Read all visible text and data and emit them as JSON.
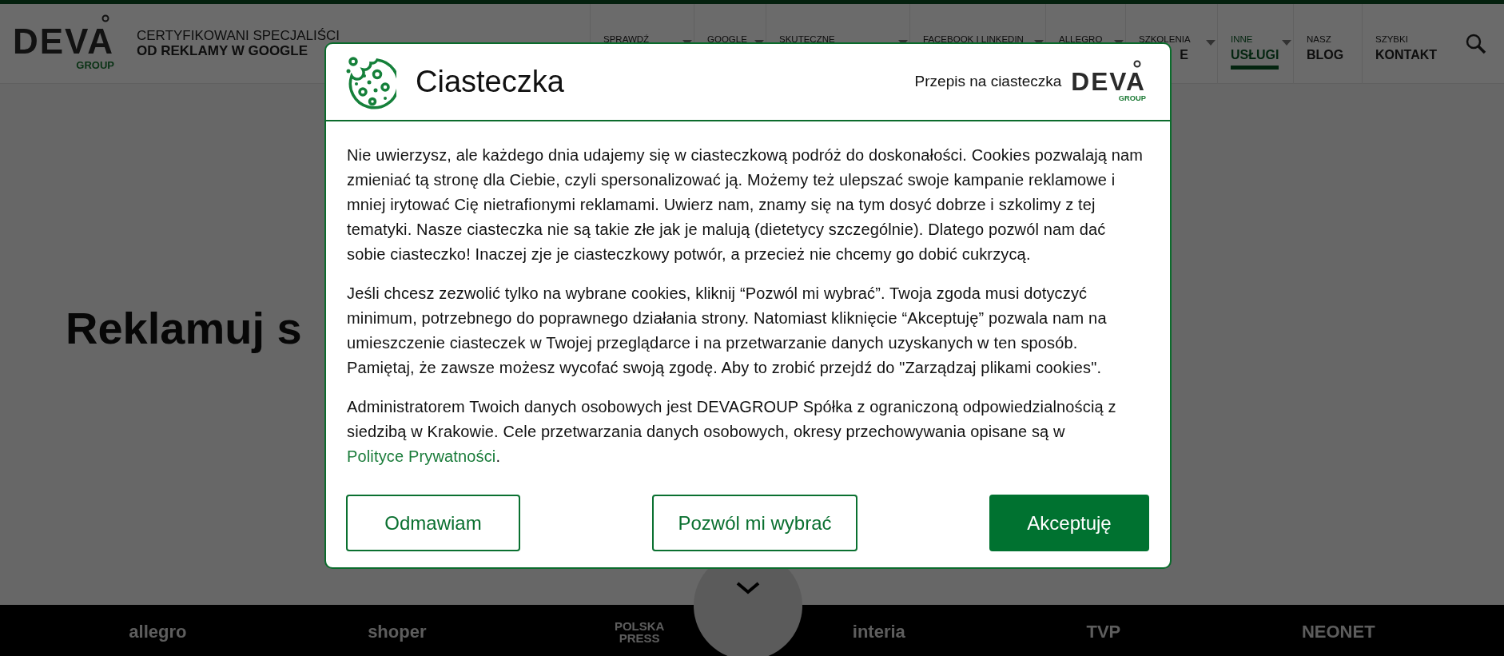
{
  "header": {
    "logo": {
      "word": "DEVA",
      "sub": "GROUP"
    },
    "tagline": {
      "top": "CERTYFIKOWANI SPECJALIŚCI",
      "bottom": "OD REKLAMY W GOOGLE"
    },
    "nav": [
      {
        "top": "SPRAWDŹ",
        "dropdown": true,
        "selected": false
      },
      {
        "top": "GOOGLE",
        "dropdown": true,
        "selected": false
      },
      {
        "top": "SKUTECZNE",
        "dropdown": true,
        "selected": false
      },
      {
        "top": "FACEBOOK I LINKEDIN",
        "dropdown": true,
        "selected": false
      },
      {
        "top": "ALLEGRO",
        "dropdown": true,
        "selected": false
      },
      {
        "top": "SZKOLENIA",
        "bottom": "E",
        "dropdown": true,
        "selected": false
      },
      {
        "top": "INNE",
        "bottom": "USŁUGI",
        "dropdown": true,
        "selected": true
      },
      {
        "top": "NASZ",
        "bottom": "BLOG",
        "dropdown": false,
        "selected": false
      },
      {
        "top": "SZYBKI",
        "bottom": "KONTAKT",
        "dropdown": false,
        "selected": false
      }
    ]
  },
  "hero": {
    "heading": "Reklamuj s"
  },
  "partners": [
    "allegro",
    "shoper",
    "POLSKA PRESS",
    "interia",
    "TVP",
    "NEONET"
  ],
  "cookie_dialog": {
    "title": "Ciasteczka",
    "recipe_link": "Przepis na ciasteczka",
    "logo": {
      "word": "DEVA",
      "sub": "GROUP"
    },
    "paragraphs": [
      {
        "text": "Nie uwierzysz, ale każdego dnia udajemy się w ciasteczkową podróż do doskonałości. Cookies pozwalają nam zmieniać tą stronę dla Ciebie, czyli spersonalizować ją. Możemy też ulepszać swoje kampanie reklamowe i mniej irytować Cię nietrafionymi reklamami. Uwierz nam, znamy się na tym dosyć dobrze i szkolimy z tej tematyki. Nasze ciasteczka nie są takie złe jak je malują (dietetycy szczególnie). Dlatego pozwól nam dać sobie ciasteczko! Inaczej zje je ciasteczkowy potwór, a przecież nie chcemy go dobić cukrzycą."
      },
      {
        "text": "Jeśli chcesz zezwolić tylko na wybrane cookies, kliknij “Pozwól mi wybrać”. Twoja zgoda musi dotyczyć minimum, potrzebnego do poprawnego działania strony. Natomiast kliknięcie “Akceptuję” pozwala nam na umieszczenie ciasteczek w Twojej przeglądarce i na przetwarzanie danych uzyskanych w ten sposób. Pamiętaj, że zawsze możesz wycofać swoją zgodę. Aby to zrobić przejdź do \"Zarządzaj plikami cookies\"."
      },
      {
        "text": "Administratorem Twoich danych osobowych jest DEVAGROUP Spółka z ograniczoną odpowiedzialnością z siedzibą w Krakowie. Cele przetwarzania danych osobowych, okresy przechowywania opisane są w",
        "link": "Polityce Prywatności",
        "after": "."
      }
    ],
    "buttons": [
      {
        "label": "Odmawiam",
        "kind": "outline"
      },
      {
        "label": "Pozwól mi wybrać",
        "kind": "outline"
      },
      {
        "label": "Akceptuję",
        "kind": "primary"
      }
    ]
  }
}
